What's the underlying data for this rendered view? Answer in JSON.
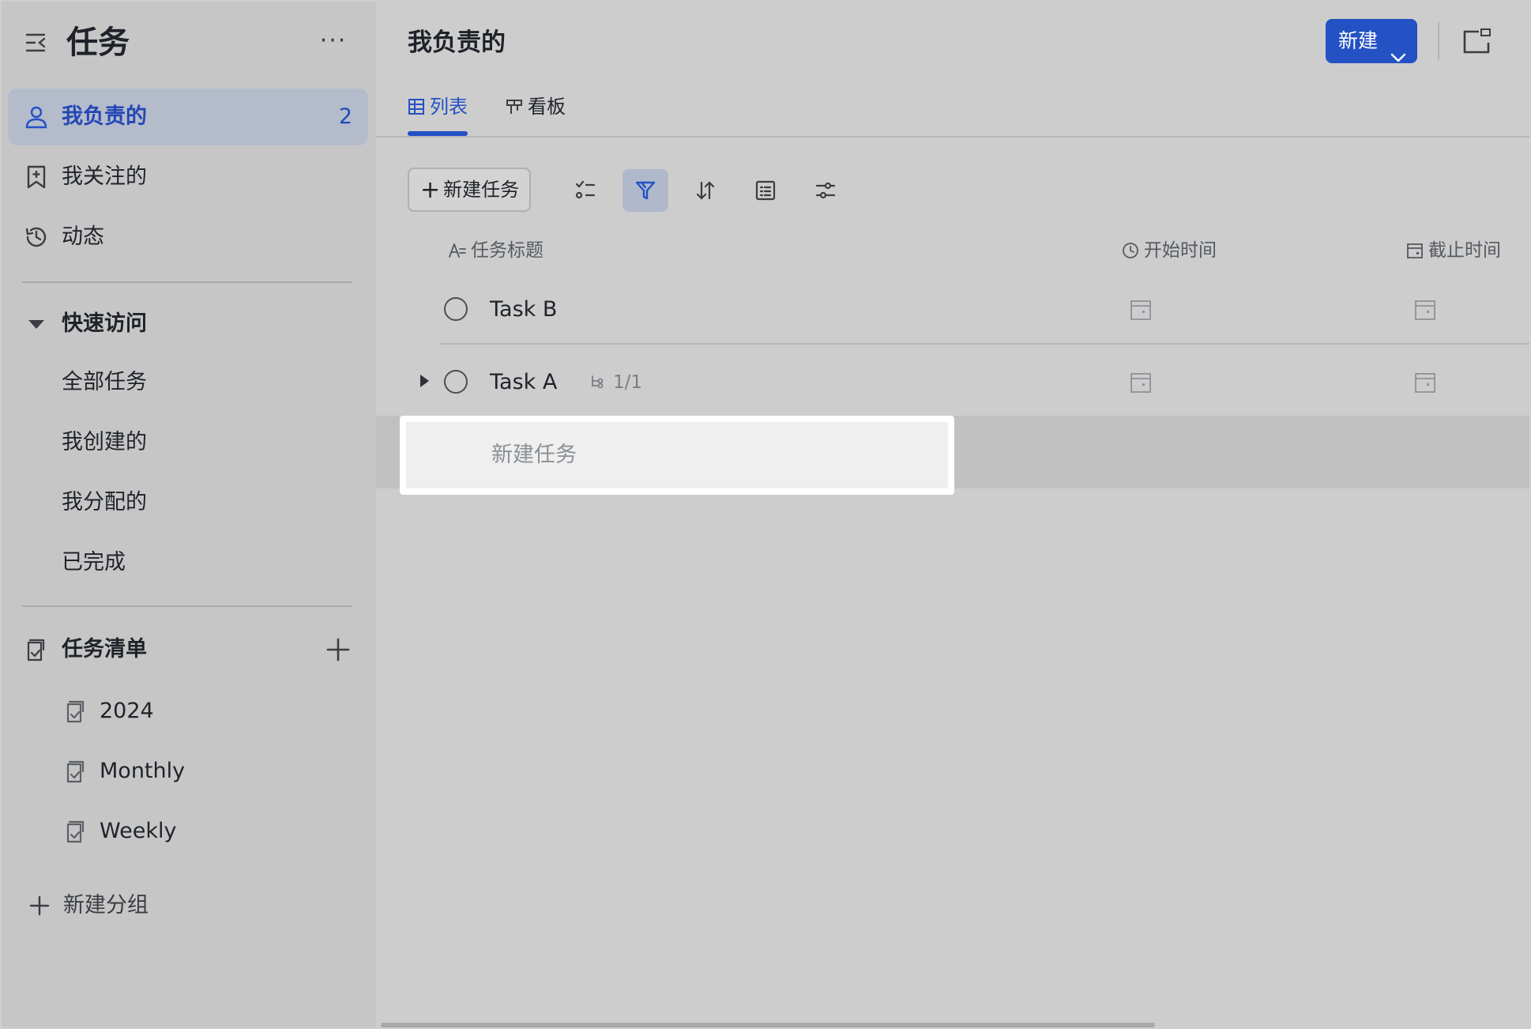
{
  "colors": {
    "accent": "#2451c4",
    "sidebar_bg": "#c6c6c6",
    "main_bg": "#cdcdcd",
    "active_nav_bg": "#b4bccb"
  },
  "sidebar": {
    "title": "任务",
    "more_label": "···",
    "nav": [
      {
        "label": "我负责的",
        "count": "2",
        "icon": "user-icon",
        "active": true
      },
      {
        "label": "我关注的",
        "icon": "bookmark-icon"
      },
      {
        "label": "动态",
        "icon": "history-icon"
      }
    ],
    "quick_access": {
      "label": "快速访问",
      "items": [
        "全部任务",
        "我创建的",
        "我分配的",
        "已完成"
      ]
    },
    "task_lists": {
      "label": "任务清单",
      "items": [
        "2024",
        "Monthly",
        "Weekly"
      ]
    },
    "new_group_label": "新建分组"
  },
  "main": {
    "title": "我负责的",
    "new_button_label": "新建",
    "tabs": [
      {
        "label": "列表",
        "icon": "table-icon",
        "active": true
      },
      {
        "label": "看板",
        "icon": "kanban-icon"
      }
    ],
    "toolbar": {
      "add_task_label": "新建任务",
      "icons": [
        "checklist-icon",
        "filter-icon",
        "sort-icon",
        "group-icon",
        "settings-sliders-icon"
      ],
      "active_icon": "filter-icon"
    },
    "columns": {
      "title": "任务标题",
      "start": "开始时间",
      "due": "截止时间"
    },
    "tasks": [
      {
        "name": "Task B"
      },
      {
        "name": "Task A",
        "subtasks": "1/1",
        "expandable": true
      }
    ],
    "new_task_placeholder": "新建任务"
  }
}
